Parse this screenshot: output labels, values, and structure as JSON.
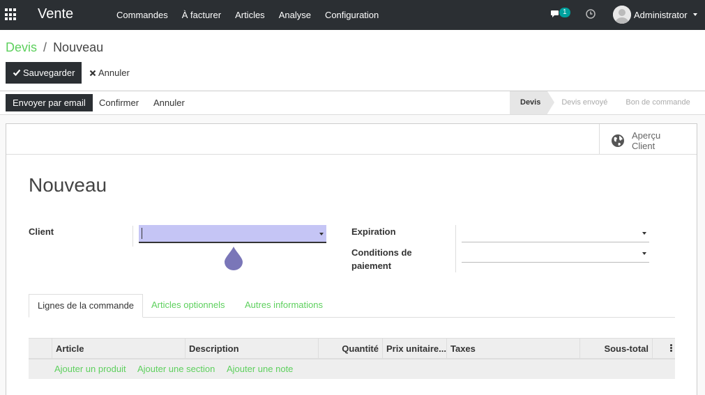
{
  "navbar": {
    "brand": "Vente",
    "menu": [
      "Commandes",
      "À facturer",
      "Articles",
      "Analyse",
      "Configuration"
    ],
    "messages_count": "1",
    "user": "Administrator"
  },
  "breadcrumb": {
    "parent": "Devis",
    "separator": "/",
    "current": "Nouveau"
  },
  "buttons": {
    "save": "Sauvegarder",
    "discard": "Annuler"
  },
  "statusbar": {
    "send_email": "Envoyer par email",
    "confirm": "Confirmer",
    "cancel": "Annuler",
    "stages": [
      "Devis",
      "Devis envoyé",
      "Bon de commande"
    ],
    "active_stage": "Devis"
  },
  "sheet": {
    "preview_line1": "Aperçu",
    "preview_line2": "Client",
    "title": "Nouveau",
    "fields": {
      "client": {
        "label": "Client",
        "value": ""
      },
      "expiration": {
        "label": "Expiration",
        "value": ""
      },
      "payment_terms": {
        "label_line1": "Conditions de",
        "label_line2": "paiement",
        "value": ""
      }
    },
    "tabs": [
      "Lignes de la commande",
      "Articles optionnels",
      "Autres informations"
    ],
    "active_tab": "Lignes de la commande",
    "table": {
      "columns": [
        "Article",
        "Description",
        "Quantité",
        "Prix unitaire...",
        "Taxes",
        "Sous-total"
      ],
      "add_links": [
        "Ajouter un produit",
        "Ajouter une section",
        "Ajouter une note"
      ]
    }
  },
  "colors": {
    "accent": "#5dd05d",
    "navbar": "#2b2f33",
    "focus_input": "#c5c5f5"
  }
}
